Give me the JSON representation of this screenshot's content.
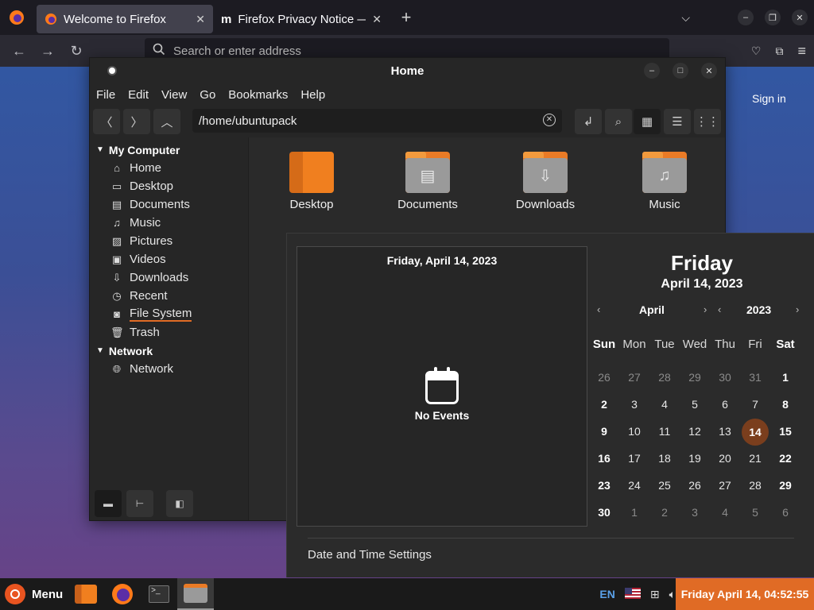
{
  "firefox": {
    "tabs": [
      {
        "title": "Welcome to Firefox",
        "active": true
      },
      {
        "title": "Firefox Privacy Notice —",
        "active": false
      }
    ],
    "url_placeholder": "Search or enter address",
    "signin": "Sign in"
  },
  "nemo": {
    "title": "Home",
    "menu": [
      "File",
      "Edit",
      "View",
      "Go",
      "Bookmarks",
      "Help"
    ],
    "path": "/home/ubuntupack",
    "sidebar": {
      "my_computer": "My Computer",
      "items": [
        {
          "label": "Home",
          "icon": "home-icon"
        },
        {
          "label": "Desktop",
          "icon": "desktop-icon"
        },
        {
          "label": "Documents",
          "icon": "documents-icon"
        },
        {
          "label": "Music",
          "icon": "music-icon"
        },
        {
          "label": "Pictures",
          "icon": "pictures-icon"
        },
        {
          "label": "Videos",
          "icon": "videos-icon"
        },
        {
          "label": "Downloads",
          "icon": "downloads-icon"
        },
        {
          "label": "Recent",
          "icon": "recent-icon"
        },
        {
          "label": "File System",
          "icon": "filesystem-icon"
        },
        {
          "label": "Trash",
          "icon": "trash-icon"
        }
      ],
      "network_head": "Network",
      "network_items": [
        {
          "label": "Network",
          "icon": "globe-icon"
        }
      ]
    },
    "files": [
      "Desktop",
      "Documents",
      "Downloads",
      "Music"
    ]
  },
  "calendar": {
    "events_date": "Friday, April 14, 2023",
    "no_events": "No Events",
    "day_name": "Friday",
    "full_date": "April 14, 2023",
    "month": "April",
    "year": "2023",
    "weekdays": [
      "Sun",
      "Mon",
      "Tue",
      "Wed",
      "Thu",
      "Fri",
      "Sat"
    ],
    "weeks": [
      [
        "26",
        "27",
        "28",
        "29",
        "30",
        "31",
        "1"
      ],
      [
        "2",
        "3",
        "4",
        "5",
        "6",
        "7",
        "8"
      ],
      [
        "9",
        "10",
        "11",
        "12",
        "13",
        "14",
        "15"
      ],
      [
        "16",
        "17",
        "18",
        "19",
        "20",
        "21",
        "22"
      ],
      [
        "23",
        "24",
        "25",
        "26",
        "27",
        "28",
        "29"
      ],
      [
        "30",
        "1",
        "2",
        "3",
        "4",
        "5",
        "6"
      ]
    ],
    "today": "14",
    "settings_label": "Date and Time Settings"
  },
  "panel": {
    "menu_label": "Menu",
    "lang": "EN",
    "clock": "Friday April 14, 04:52:55",
    "accent": "#e06b25"
  }
}
